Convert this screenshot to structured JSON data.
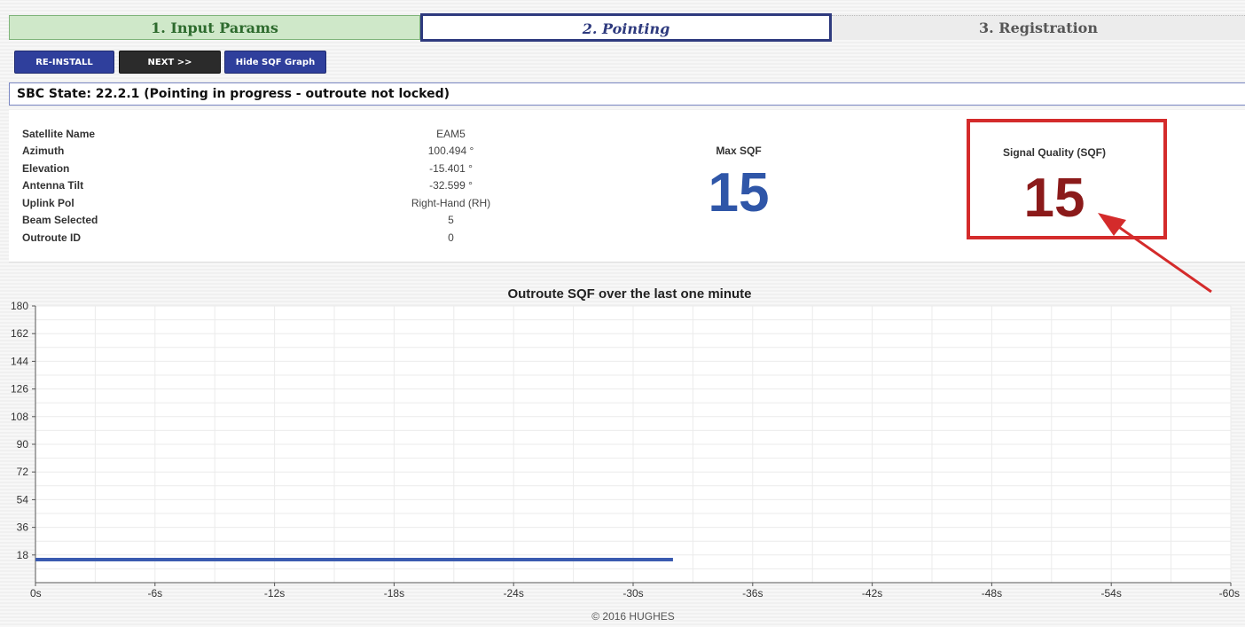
{
  "tabs": [
    {
      "label": "1. Input Params",
      "state": "done"
    },
    {
      "label": "2. Pointing",
      "state": "active"
    },
    {
      "label": "3. Registration",
      "state": "pending"
    }
  ],
  "buttons": {
    "reinstall": "RE-INSTALL",
    "next": "NEXT >>",
    "hide_graph": "Hide SQF Graph"
  },
  "state_bar": "SBC State: 22.2.1 (Pointing in progress - outroute not locked)",
  "info": {
    "rows": [
      {
        "label": "Satellite Name",
        "value": "EAM5"
      },
      {
        "label": "Azimuth",
        "value": "100.494 °"
      },
      {
        "label": "Elevation",
        "value": "-15.401 °"
      },
      {
        "label": "Antenna Tilt",
        "value": "-32.599 °"
      },
      {
        "label": "Uplink Pol",
        "value": "Right-Hand (RH)"
      },
      {
        "label": "Beam Selected",
        "value": "5"
      },
      {
        "label": "Outroute ID",
        "value": "0"
      }
    ],
    "max_sqf_label": "Max SQF",
    "max_sqf_value": "15",
    "sqf_label": "Signal Quality (SQF)",
    "sqf_value": "15"
  },
  "colors": {
    "max_sqf": "#2f56a8",
    "sqf": "#8b1a1a",
    "highlight": "#d42b2b",
    "series": "#3a5bb0"
  },
  "chart_data": {
    "type": "line",
    "title": "Outroute SQF over the last one minute",
    "xlabel": "",
    "ylabel": "",
    "x_ticks": [
      "0s",
      "-6s",
      "-12s",
      "-18s",
      "-24s",
      "-30s",
      "-36s",
      "-42s",
      "-48s",
      "-54s",
      "-60s"
    ],
    "y_ticks": [
      "18",
      "36",
      "54",
      "72",
      "90",
      "108",
      "126",
      "144",
      "162",
      "180"
    ],
    "xlim": [
      0,
      -60
    ],
    "ylim": [
      0,
      180
    ],
    "grid": true,
    "series": [
      {
        "values": [
          [
            0,
            15
          ],
          [
            -32,
            15
          ]
        ]
      }
    ]
  },
  "footer": "© 2016 HUGHES"
}
